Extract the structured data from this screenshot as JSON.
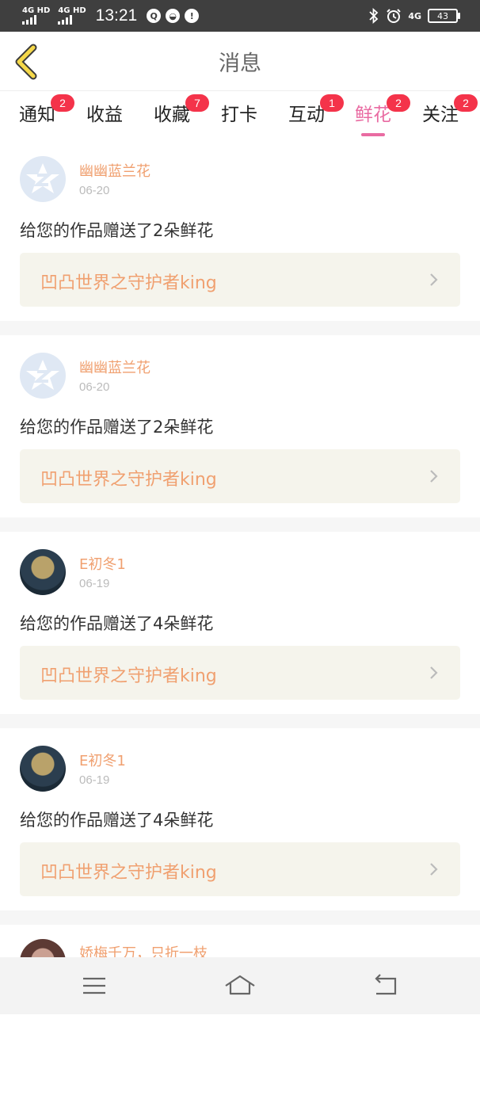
{
  "status_bar": {
    "signal1_label": "4G HD",
    "signal2_label": "4G HD",
    "time": "13:21",
    "notif_icons": [
      "qq-icon",
      "cloud-icon",
      "alert-icon"
    ],
    "right_icons": [
      "bluetooth-icon",
      "alarm-icon"
    ],
    "mobile_data_label": "4G",
    "battery": "43"
  },
  "header": {
    "title": "消息",
    "back_icon": "back-chevron-icon"
  },
  "tabs": [
    {
      "label": "通知",
      "badge": "2"
    },
    {
      "label": "收益",
      "badge": ""
    },
    {
      "label": "收藏",
      "badge": "7"
    },
    {
      "label": "打卡",
      "badge": ""
    },
    {
      "label": "互动",
      "badge": "1"
    },
    {
      "label": "鲜花",
      "badge": "2",
      "active": true
    },
    {
      "label": "关注",
      "badge": "2"
    }
  ],
  "messages": [
    {
      "user": "幽幽蓝兰花",
      "date": "06-20",
      "text": "给您的作品赠送了2朵鲜花",
      "work": "凹凸世界之守护者king"
    },
    {
      "user": "幽幽蓝兰花",
      "date": "06-20",
      "text": "给您的作品赠送了2朵鲜花",
      "work": "凹凸世界之守护者king"
    },
    {
      "user": "E初冬1",
      "date": "06-19",
      "text": "给您的作品赠送了4朵鲜花",
      "work": "凹凸世界之守护者king"
    },
    {
      "user": "E初冬1",
      "date": "06-19",
      "text": "给您的作品赠送了4朵鲜花",
      "work": "凹凸世界之守护者king"
    }
  ],
  "partial_message": {
    "user": "娇梅千万，只折一枝"
  },
  "colors": {
    "accent": "#e96ba2",
    "badge": "#f4334a",
    "name": "#f0a070",
    "back_arrow": "#f5d84a"
  },
  "nav_bar": {
    "icons": [
      "menu-icon",
      "home-icon",
      "back-icon"
    ]
  }
}
